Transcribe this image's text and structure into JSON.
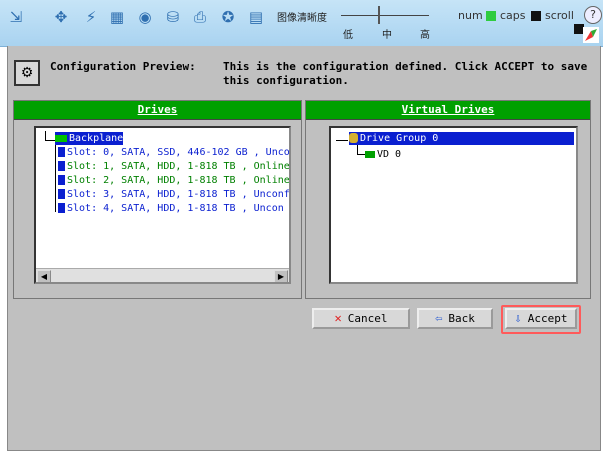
{
  "toolbar": {
    "icons": [
      "pin-icon",
      "move-icon",
      "power-icon",
      "screen-icon",
      "disc-icon",
      "drive-icon",
      "printer-icon",
      "media-icon",
      "grid-icon"
    ],
    "quality_label": "图像清晰度",
    "quality_levels": [
      "低",
      "中",
      "高"
    ],
    "num_label": "num",
    "caps_label": "caps",
    "scroll_label": "scroll",
    "num_color": "#2ecc40",
    "caps_color": "#111111",
    "scroll_color": "#111111",
    "help_glyph": "?"
  },
  "main": {
    "config_preview_label": "Configuration Preview:",
    "config_message": "This is the configuration defined. Click ACCEPT to save this configuration.",
    "drives_panel": {
      "title": "Drives",
      "root": "Backplane",
      "slots": [
        {
          "text": "Slot: 0, SATA, SSD, 446-102 GB , Unco",
          "color": "blue"
        },
        {
          "text": "Slot: 1, SATA, HDD, 1-818 TB , Online",
          "color": "green"
        },
        {
          "text": "Slot: 2, SATA, HDD, 1-818 TB , Online",
          "color": "green"
        },
        {
          "text": "Slot: 3, SATA, HDD, 1-818 TB , Unconf",
          "color": "blue"
        },
        {
          "text": "Slot: 4, SATA, HDD, 1-818 TB , Uncon",
          "color": "blue"
        }
      ]
    },
    "virtual_drives_panel": {
      "title": "Virtual Drives",
      "group": "Drive Group 0",
      "vd": "VD 0"
    },
    "buttons": {
      "cancel": "Cancel",
      "back": "Back",
      "accept": "Accept"
    }
  },
  "colors": {
    "header_green": "#00a000",
    "selection_blue": "#0a1fd0",
    "highlight_red": "#ff5a5a"
  }
}
